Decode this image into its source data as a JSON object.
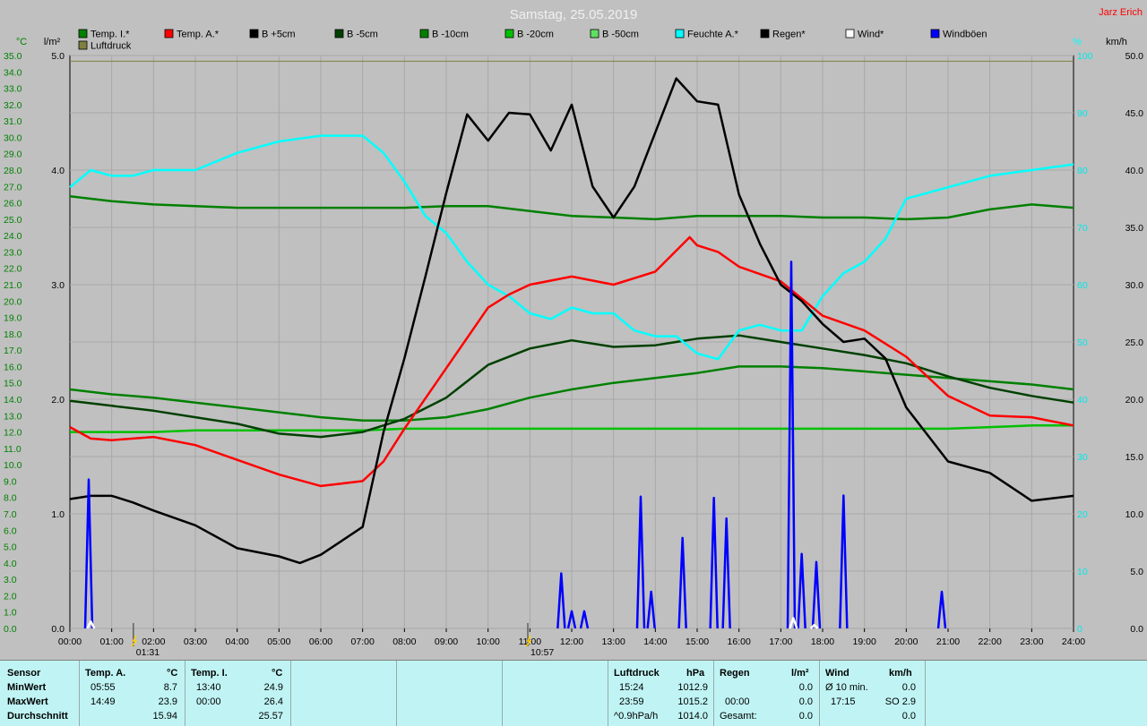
{
  "title": "Samstag, 25.05.2019",
  "author": "Jarz Erich",
  "axes": {
    "left1_unit": "°C",
    "left2_unit": "l/m²",
    "right1_unit": "%",
    "right2_unit": "km/h",
    "temp_ticks": [
      "35.0",
      "34.0",
      "33.0",
      "32.0",
      "31.0",
      "30.0",
      "29.0",
      "28.0",
      "27.0",
      "26.0",
      "25.0",
      "24.0",
      "23.0",
      "22.0",
      "21.0",
      "20.0",
      "19.0",
      "18.0",
      "17.0",
      "16.0",
      "15.0",
      "14.0",
      "13.0",
      "12.0",
      "11.0",
      "10.0",
      "9.0",
      "8.0",
      "7.0",
      "6.0",
      "5.0",
      "4.0",
      "3.0",
      "2.0",
      "1.0",
      "0.0"
    ],
    "rain_ticks": [
      "5.0",
      "4.0",
      "3.0",
      "2.0",
      "1.0",
      "0.0"
    ],
    "hum_ticks": [
      "100",
      "90",
      "80",
      "70",
      "60",
      "50",
      "40",
      "30",
      "20",
      "10",
      "0"
    ],
    "wind_ticks": [
      "50.0",
      "45.0",
      "40.0",
      "35.0",
      "30.0",
      "25.0",
      "20.0",
      "15.0",
      "10.0",
      "5.0",
      "0.0"
    ],
    "time_ticks": [
      "00:00",
      "01:00",
      "02:00",
      "03:00",
      "04:00",
      "05:00",
      "06:00",
      "07:00",
      "08:00",
      "09:00",
      "10:00",
      "11:00",
      "12:00",
      "13:00",
      "14:00",
      "15:00",
      "16:00",
      "17:00",
      "18:00",
      "19:00",
      "20:00",
      "21:00",
      "22:00",
      "23:00",
      "24:00"
    ]
  },
  "legend": [
    {
      "label": "Temp. I.*",
      "color": "#008000"
    },
    {
      "label": "Temp. A.*",
      "color": "#ff0000"
    },
    {
      "label": "B +5cm",
      "color": "#000000"
    },
    {
      "label": "B -5cm",
      "color": "#004000"
    },
    {
      "label": "B -10cm",
      "color": "#008000"
    },
    {
      "label": "B -20cm",
      "color": "#00c000"
    },
    {
      "label": "B -50cm",
      "color": "#60e060"
    },
    {
      "label": "Feuchte A.*",
      "color": "#00ffff"
    },
    {
      "label": "Regen*",
      "color": "#000000"
    },
    {
      "label": "Wind*",
      "color": "#ffffff"
    },
    {
      "label": "Windböen",
      "color": "#0000ff"
    },
    {
      "label": "Luftdruck",
      "color": "#808040"
    }
  ],
  "markers": [
    {
      "time": "01:31",
      "label": "01:31"
    },
    {
      "time": "10:57",
      "label": "10:57"
    }
  ],
  "chart_data": {
    "type": "line",
    "title": "Samstag, 25.05.2019",
    "x_unit": "hours",
    "xlim": [
      0,
      24
    ],
    "ylim_temp": [
      0,
      35
    ],
    "ylim_rain": [
      0,
      5
    ],
    "ylim_humidity": [
      0,
      100
    ],
    "ylim_wind": [
      0,
      50
    ],
    "grid": true,
    "series": [
      {
        "name": "Temp. I.*",
        "axis": "temp",
        "color": "#008000",
        "x": [
          0,
          1,
          2,
          3,
          4,
          5,
          6,
          7,
          8,
          9,
          10,
          11,
          12,
          13,
          14,
          15,
          16,
          17,
          18,
          19,
          20,
          21,
          22,
          23,
          24
        ],
        "y": [
          26.4,
          26.1,
          25.9,
          25.8,
          25.7,
          25.7,
          25.7,
          25.7,
          25.7,
          25.8,
          25.8,
          25.5,
          25.2,
          25.1,
          25.0,
          25.2,
          25.2,
          25.2,
          25.1,
          25.1,
          25.0,
          25.1,
          25.6,
          25.9,
          25.7
        ]
      },
      {
        "name": "Temp. A.*",
        "axis": "temp",
        "color": "#ff0000",
        "x": [
          0,
          0.5,
          1,
          2,
          3,
          4,
          5,
          6,
          7,
          7.5,
          8,
          9,
          10,
          10.5,
          11,
          12,
          13,
          14,
          14.82,
          15,
          15.5,
          16,
          17,
          18,
          19,
          20,
          21,
          22,
          23,
          24
        ],
        "y": [
          12.3,
          11.6,
          11.5,
          11.7,
          11.2,
          10.3,
          9.4,
          8.7,
          9.0,
          10.2,
          12.2,
          15.9,
          19.6,
          20.4,
          21.0,
          21.5,
          21.0,
          21.8,
          23.9,
          23.4,
          23.0,
          22.1,
          21.2,
          19.1,
          18.2,
          16.6,
          14.2,
          13.0,
          12.9,
          12.4
        ]
      },
      {
        "name": "B +5cm",
        "axis": "temp",
        "color": "#000000",
        "x": [
          0,
          0.5,
          1,
          1.5,
          2,
          3,
          4,
          5,
          5.5,
          6,
          7,
          7.5,
          8,
          8.5,
          9,
          9.5,
          10,
          10.5,
          11,
          11.5,
          12,
          12.5,
          13,
          13.5,
          14,
          14.5,
          15,
          15.5,
          16,
          16.5,
          17,
          17.5,
          18,
          18.5,
          19,
          19.5,
          20,
          21,
          22,
          23,
          24
        ],
        "y": [
          7.9,
          8.1,
          8.1,
          7.7,
          7.2,
          6.3,
          4.9,
          4.4,
          4.0,
          4.5,
          6.2,
          12.0,
          16.5,
          21.5,
          26.6,
          31.4,
          29.8,
          31.5,
          31.4,
          29.2,
          32.0,
          27.0,
          25.1,
          27.0,
          30.3,
          33.6,
          32.2,
          32.0,
          26.5,
          23.5,
          21.0,
          20.0,
          18.6,
          17.5,
          17.7,
          16.5,
          13.5,
          10.2,
          9.5,
          7.8,
          8.1
        ]
      },
      {
        "name": "B -5cm",
        "axis": "temp",
        "color": "#004000",
        "x": [
          0,
          1,
          2,
          3,
          4,
          5,
          6,
          7,
          8,
          9,
          10,
          11,
          12,
          13,
          14,
          15,
          16,
          17,
          18,
          19,
          20,
          21,
          22,
          23,
          24
        ],
        "y": [
          13.9,
          13.6,
          13.3,
          12.9,
          12.5,
          11.9,
          11.7,
          12.0,
          12.8,
          14.1,
          16.1,
          17.1,
          17.6,
          17.2,
          17.3,
          17.7,
          17.9,
          17.5,
          17.1,
          16.7,
          16.2,
          15.4,
          14.7,
          14.2,
          13.8
        ]
      },
      {
        "name": "B -10cm",
        "axis": "temp",
        "color": "#008000",
        "x": [
          0,
          1,
          2,
          3,
          4,
          5,
          6,
          7,
          8,
          9,
          10,
          11,
          12,
          13,
          14,
          15,
          16,
          17,
          18,
          19,
          20,
          21,
          22,
          23,
          24
        ],
        "y": [
          14.6,
          14.3,
          14.1,
          13.8,
          13.5,
          13.2,
          12.9,
          12.7,
          12.7,
          12.9,
          13.4,
          14.1,
          14.6,
          15.0,
          15.3,
          15.6,
          16.0,
          16.0,
          15.9,
          15.7,
          15.5,
          15.3,
          15.1,
          14.9,
          14.6
        ]
      },
      {
        "name": "B -20cm",
        "axis": "temp",
        "color": "#00c000",
        "x": [
          0,
          1,
          2,
          3,
          4,
          5,
          6,
          7,
          8,
          9,
          10,
          11,
          12,
          13,
          14,
          15,
          16,
          17,
          18,
          19,
          20,
          21,
          22,
          23,
          24
        ],
        "y": [
          12.0,
          12.0,
          12.0,
          12.1,
          12.1,
          12.1,
          12.1,
          12.1,
          12.2,
          12.2,
          12.2,
          12.2,
          12.2,
          12.2,
          12.2,
          12.2,
          12.2,
          12.2,
          12.2,
          12.2,
          12.2,
          12.2,
          12.3,
          12.4,
          12.4
        ]
      },
      {
        "name": "Feuchte A.*",
        "axis": "humidity",
        "color": "#00ffff",
        "x": [
          0,
          0.5,
          1,
          1.5,
          2,
          3,
          4,
          5,
          6,
          7,
          7.5,
          8,
          8.5,
          9,
          9.5,
          10,
          10.5,
          11,
          11.5,
          12,
          12.5,
          13,
          13.5,
          14,
          14.5,
          15,
          15.5,
          16,
          16.5,
          17,
          17.5,
          18,
          18.5,
          19,
          19.5,
          20,
          21,
          22,
          23,
          24
        ],
        "y": [
          77,
          80,
          79,
          79,
          80,
          80,
          83,
          85,
          86,
          86,
          83,
          78,
          72,
          69,
          64,
          60,
          58,
          55,
          54,
          56,
          55,
          55,
          52,
          51,
          51,
          48,
          47,
          52,
          53,
          52,
          52,
          58,
          62,
          64,
          68,
          75,
          77,
          79,
          80,
          81
        ]
      },
      {
        "name": "Luftdruck",
        "axis": "humidity",
        "color": "#808040",
        "x": [
          0,
          1,
          2,
          3,
          4,
          5,
          6,
          7,
          8,
          9,
          10,
          11,
          12,
          13,
          14,
          15,
          16,
          17,
          18,
          19,
          20,
          21,
          22,
          23,
          24
        ],
        "y": [
          99,
          99,
          99,
          99,
          99,
          99,
          99,
          99,
          99,
          99,
          99,
          99,
          99,
          99,
          99,
          99,
          99,
          99,
          99,
          99,
          99,
          99,
          99,
          99,
          99
        ]
      },
      {
        "name": "Windböen",
        "axis": "wind",
        "color": "#0000ff",
        "type": "spikes",
        "peaks": [
          [
            0.45,
            13.0
          ],
          [
            11.75,
            4.8
          ],
          [
            12.0,
            1.5
          ],
          [
            12.3,
            1.5
          ],
          [
            13.65,
            11.5
          ],
          [
            13.9,
            3.2
          ],
          [
            14.65,
            7.9
          ],
          [
            15.4,
            11.4
          ],
          [
            15.7,
            9.6
          ],
          [
            17.25,
            32.0
          ],
          [
            17.5,
            6.5
          ],
          [
            17.85,
            5.8
          ],
          [
            18.5,
            11.6
          ],
          [
            20.85,
            3.2
          ]
        ]
      },
      {
        "name": "Wind*",
        "axis": "wind",
        "color": "#ffffff",
        "type": "spikes",
        "peaks": [
          [
            0.5,
            0.6
          ],
          [
            17.3,
            0.9
          ],
          [
            17.8,
            0.3
          ]
        ]
      }
    ]
  },
  "stats": {
    "sensor_header": "Sensor",
    "min_label": "MinWert",
    "max_label": "MaxWert",
    "avg_label": "Durchschnitt",
    "ta_header": "Temp. A.",
    "ta_unit": "°C",
    "ta_min_time": "05:55",
    "ta_min_val": "8.7",
    "ta_max_time": "14:49",
    "ta_max_val": "23.9",
    "ta_avg": "15.94",
    "ti_header": "Temp. I.",
    "ti_unit": "°C",
    "ti_min_time": "13:40",
    "ti_min_val": "24.9",
    "ti_max_time": "00:00",
    "ti_max_val": "26.4",
    "ti_avg": "25.57",
    "lp_header": "Luftdruck",
    "lp_unit": "hPa",
    "lp_min_time": "15:24",
    "lp_min_val": "1012.9",
    "lp_max_time": "23:59",
    "lp_max_val": "1015.2",
    "lp_avg_label": "^0.9hPa/h",
    "lp_avg_val": "1014.0",
    "rain_header": "Regen",
    "rain_unit": "l/m²",
    "rain_min_val": "0.0",
    "rain_max_time": "00:00",
    "rain_max_val": "0.0",
    "rain_total_label": "Gesamt:",
    "rain_total_val": "0.0",
    "wind_header": "Wind",
    "wind_unit": "km/h",
    "wind_min_label": "Ø 10 min.",
    "wind_min_val": "0.0",
    "wind_max_time": "17:15",
    "wind_max_val": "SO 2.9",
    "wind_avg_val": "0.0"
  }
}
